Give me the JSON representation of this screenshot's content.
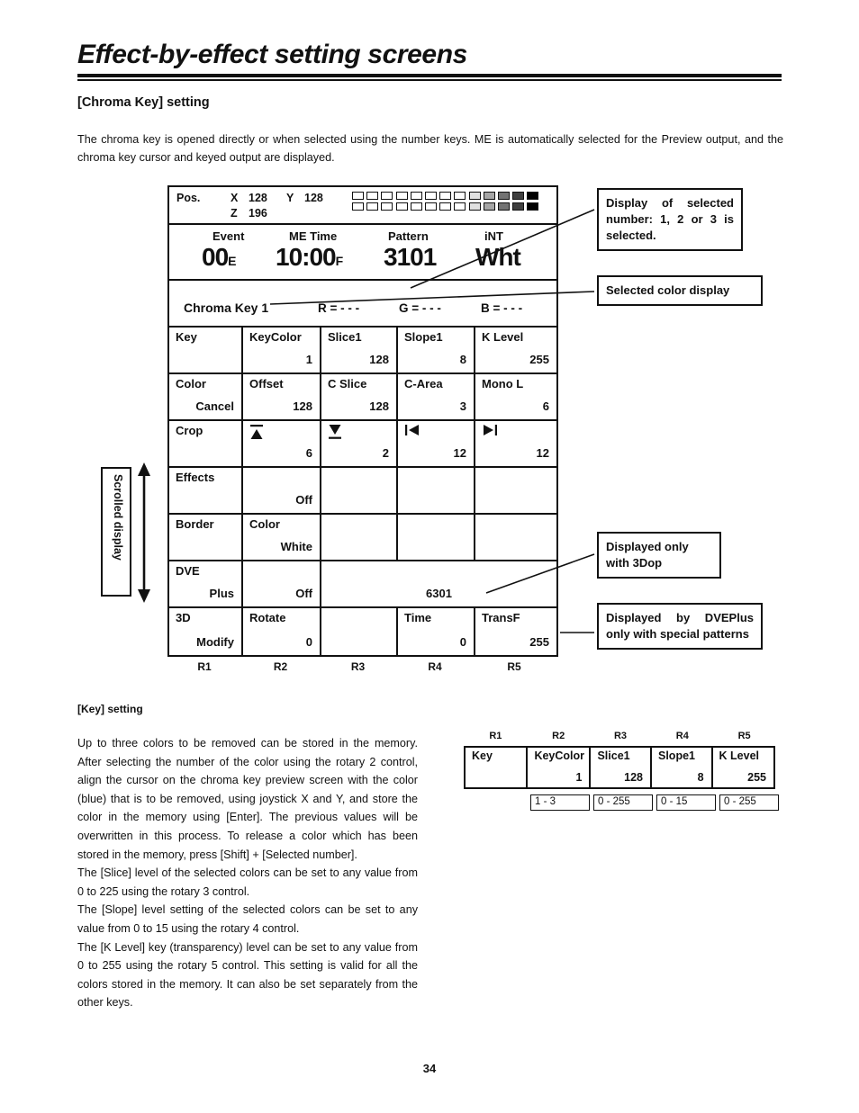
{
  "header": {
    "title": "Effect-by-effect setting screens",
    "section": "[Chroma Key] setting",
    "intro": "The chroma key is opened directly or when selected using the number keys.  ME is automatically selected for the Preview output, and the chroma key cursor and keyed output are displayed."
  },
  "panel": {
    "pos": {
      "label": "Pos.",
      "x_label": "X",
      "x_value": "128",
      "y_label": "Y",
      "y_value": "128",
      "z_label": "Z",
      "z_value": "196",
      "bar_levels": [
        0,
        0,
        0,
        0,
        0,
        0,
        0,
        0,
        12,
        35,
        55,
        75,
        100
      ]
    },
    "status": {
      "event_label": "Event",
      "event_value": "00",
      "event_unit": "E",
      "metime_label": "ME Time",
      "metime_value": "10:00",
      "metime_unit": "F",
      "pattern_label": "Pattern",
      "pattern_value": "3101",
      "color_label": "iNT",
      "color_value": "Wht"
    },
    "chroma": {
      "name": "Chroma Key 1",
      "r": "R = - - -",
      "g": "G = - - -",
      "b": "B = - - -"
    },
    "rows": [
      {
        "name": "row-key",
        "cells": [
          {
            "label": "Key",
            "value": "",
            "align": "right"
          },
          {
            "label": "KeyColor",
            "value": "1",
            "align": "right"
          },
          {
            "label": "Slice1",
            "value": "128",
            "align": "right"
          },
          {
            "label": "Slope1",
            "value": "8",
            "align": "right"
          },
          {
            "label": "K Level",
            "value": "255",
            "align": "right"
          }
        ]
      },
      {
        "name": "row-color",
        "cells": [
          {
            "label": "Color",
            "value": "Cancel",
            "align": "right"
          },
          {
            "label": "Offset",
            "value": "128",
            "align": "right"
          },
          {
            "label": "C Slice",
            "value": "128",
            "align": "right"
          },
          {
            "label": "C-Area",
            "value": "3",
            "align": "right"
          },
          {
            "label": "Mono L",
            "value": "6",
            "align": "right"
          }
        ]
      },
      {
        "name": "row-crop",
        "cells": [
          {
            "label": "Crop",
            "value": "",
            "align": "right"
          },
          {
            "label": "",
            "icon": "crop-up-icon",
            "value": "6",
            "align": "right"
          },
          {
            "label": "",
            "icon": "crop-down-icon",
            "value": "2",
            "align": "right"
          },
          {
            "label": "",
            "icon": "crop-left-icon",
            "value": "12",
            "align": "right"
          },
          {
            "label": "",
            "icon": "crop-right-icon",
            "value": "12",
            "align": "right"
          }
        ]
      },
      {
        "name": "row-effects",
        "cells": [
          {
            "label": "Effects",
            "value": "",
            "align": "right"
          },
          {
            "label": "",
            "value": "Off",
            "align": "right"
          },
          {
            "label": "",
            "value": "",
            "align": "right"
          },
          {
            "label": "",
            "value": "",
            "align": "right"
          },
          {
            "label": "",
            "value": "",
            "align": "right"
          }
        ]
      },
      {
        "name": "row-border",
        "cells": [
          {
            "label": "Border",
            "value": "",
            "align": "right"
          },
          {
            "label": "Color",
            "value": "White",
            "align": "right"
          },
          {
            "label": "",
            "value": "",
            "align": "right"
          },
          {
            "label": "",
            "value": "",
            "align": "right"
          },
          {
            "label": "",
            "value": "",
            "align": "right"
          }
        ]
      },
      {
        "name": "row-dve",
        "merged": true,
        "cells": [
          {
            "label": "DVE",
            "value": "Plus",
            "align": "right"
          },
          {
            "label": "",
            "value": "Off",
            "align": "right"
          },
          {
            "label": "",
            "value": "6301",
            "align": "center"
          }
        ]
      },
      {
        "name": "row-3d",
        "cells": [
          {
            "label": "3D",
            "value": "Modify",
            "align": "right"
          },
          {
            "label": "Rotate",
            "value": "0",
            "align": "right"
          },
          {
            "label": "",
            "value": "",
            "align": "right"
          },
          {
            "label": "Time",
            "value": "0",
            "align": "right"
          },
          {
            "label": "TransF",
            "value": "255",
            "align": "right"
          }
        ]
      }
    ],
    "rotary_labels": [
      "R1",
      "R2",
      "R3",
      "R4",
      "R5"
    ]
  },
  "scrolled_display": {
    "label": "Scrolled display"
  },
  "callouts": [
    {
      "id": "co1",
      "text": "Display of selected number: 1, 2 or 3 is selected."
    },
    {
      "id": "co2",
      "text": "Selected color display"
    },
    {
      "id": "co3",
      "text": "Displayed only with 3Dop"
    },
    {
      "id": "co4",
      "text": "Displayed by DVEPlus only with special patterns"
    }
  ],
  "key_section": {
    "title": "[Key] setting",
    "paragraphs": [
      "Up to three colors to be removed can be stored in the memory.  After selecting the number of the color using the rotary 2 control, align the cursor on the chroma key preview screen with the color (blue) that is to be removed, using joystick X and Y, and store the color in the memory using [Enter].  The previous values will be overwritten in this process.  To release a color which has been stored in the memory, press [Shift] + [Selected number].",
      "The [Slice] level of the selected colors can be set to any value from 0 to 225 using the rotary 3 control.",
      "The [Slope] level setting of the selected colors can be set to any value from 0 to 15 using the rotary 4 control.",
      "The [K Level] key (transparency) level can be set to any value from 0 to 255 using the rotary 5 control.  This setting is valid for all the colors stored in the memory.  It can also be set separately from the other keys."
    ],
    "table": {
      "rotary_labels": [
        "R1",
        "R2",
        "R3",
        "R4",
        "R5"
      ],
      "cells": [
        {
          "label": "Key",
          "value": ""
        },
        {
          "label": "KeyColor",
          "value": "1"
        },
        {
          "label": "Slice1",
          "value": "128"
        },
        {
          "label": "Slope1",
          "value": "8"
        },
        {
          "label": "K Level",
          "value": "255"
        }
      ],
      "ranges": [
        "",
        "1 - 3",
        "0 - 255",
        "0 - 15",
        "0 - 255"
      ]
    }
  },
  "footer": {
    "page_number": "34"
  }
}
